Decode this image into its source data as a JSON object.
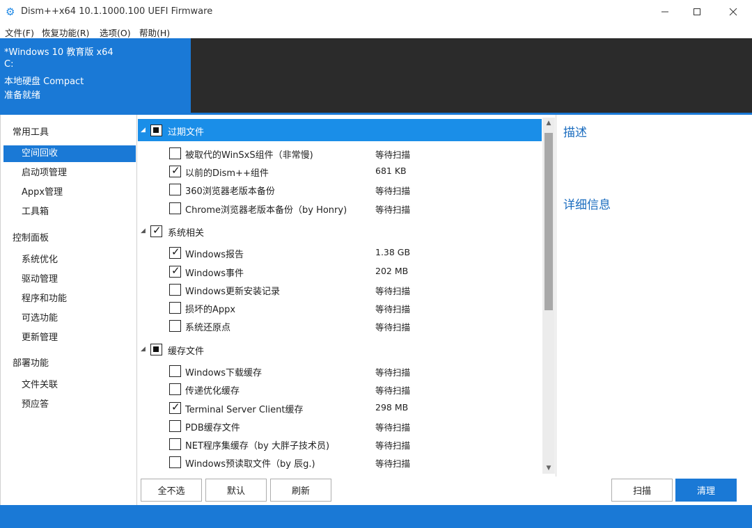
{
  "window": {
    "title": "Dism++x64 10.1.1000.100 UEFI Firmware",
    "minimize_glyph": "—",
    "maximize_glyph": "☐",
    "close_glyph": "✕",
    "icon": "gear-icon"
  },
  "menu": [
    "文件(F)",
    "恢复功能(R)",
    "选项(O)",
    "帮助(H)"
  ],
  "header": {
    "lines": [
      "*Windows 10 教育版 x64",
      "C:",
      "本地硬盘 Compact",
      "准备就绪"
    ],
    "accent": "#1a79d6"
  },
  "sidebar": {
    "groups": [
      {
        "label": "常用工具",
        "items": [
          "空间回收",
          "启动项管理",
          "Appx管理",
          "工具箱"
        ]
      },
      {
        "label": "控制面板",
        "items": [
          "系统优化",
          "驱动管理",
          "程序和功能",
          "可选功能",
          "更新管理"
        ]
      },
      {
        "label": "部署功能",
        "items": [
          "文件关联",
          "预应答"
        ]
      }
    ],
    "active_item": "空间回收"
  },
  "tree": {
    "groups": [
      {
        "label": "过期文件",
        "state": "partial",
        "items": [
          {
            "label": "被取代的WinSxS组件（非常慢)",
            "status": "等待扫描",
            "checked": false
          },
          {
            "label": "以前的Dism++组件",
            "status": "681 KB",
            "checked": true
          },
          {
            "label": "360浏览器老版本备份",
            "status": "等待扫描",
            "checked": false
          },
          {
            "label": "Chrome浏览器老版本备份（by Honry)",
            "status": "等待扫描",
            "checked": false
          }
        ]
      },
      {
        "label": "系统相关",
        "state": "checked",
        "items": [
          {
            "label": "Windows报告",
            "status": "1.38 GB",
            "checked": true
          },
          {
            "label": "Windows事件",
            "status": "202 MB",
            "checked": true
          },
          {
            "label": "Windows更新安装记录",
            "status": "等待扫描",
            "checked": false
          },
          {
            "label": "损坏的Appx",
            "status": "等待扫描",
            "checked": false
          },
          {
            "label": "系统还原点",
            "status": "等待扫描",
            "checked": false
          }
        ]
      },
      {
        "label": "缓存文件",
        "state": "partial",
        "items": [
          {
            "label": "Windows下载缓存",
            "status": "等待扫描",
            "checked": false
          },
          {
            "label": "传递优化缓存",
            "status": "等待扫描",
            "checked": false
          },
          {
            "label": "Terminal Server Client缓存",
            "status": "298 MB",
            "checked": true
          },
          {
            "label": "PDB缓存文件",
            "status": "等待扫描",
            "checked": false
          },
          {
            "label": "NET程序集缓存（by 大胖子技术员)",
            "status": "等待扫描",
            "checked": false
          },
          {
            "label": "Windows预读取文件（by 辰g.)",
            "status": "等待扫描",
            "checked": false
          }
        ]
      }
    ]
  },
  "right_panel": {
    "description_title": "描述",
    "details_title": "详细信息"
  },
  "buttons": {
    "deselect_all": "全不选",
    "default": "默认",
    "refresh": "刷新",
    "scan": "扫描",
    "clean": "清理"
  }
}
